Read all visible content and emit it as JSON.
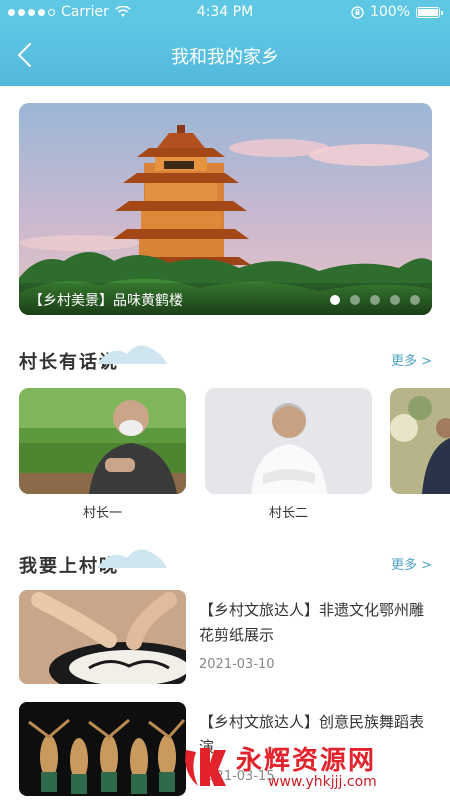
{
  "status": {
    "carrier": "Carrier",
    "time": "4:34 PM",
    "battery": "100%"
  },
  "nav": {
    "title": "我和我的家乡",
    "icon": "chevron-left-icon"
  },
  "banner": {
    "caption": "【乡村美景】品味黄鹤楼",
    "page_count": 5,
    "active_page": 1
  },
  "section_chief": {
    "title": "村长有话说",
    "more": "更多 >",
    "items": [
      {
        "name": "村长一"
      },
      {
        "name": "村长二"
      }
    ]
  },
  "section_evening": {
    "title": "我要上村晚",
    "more": "更多 >",
    "articles": [
      {
        "title": "【乡村文旅达人】非遗文化鄂州雕花剪纸展示",
        "date": "2021-03-10"
      },
      {
        "title": "【乡村文旅达人】创意民族舞蹈表演",
        "date": "2021-03-15"
      }
    ]
  },
  "watermark": {
    "title": "永辉资源网",
    "url": "www.yhkjjj.com"
  },
  "colors": {
    "header": "#5ec7e4",
    "accent": "#4fa3c4",
    "watermark_red": "#e2232c"
  }
}
